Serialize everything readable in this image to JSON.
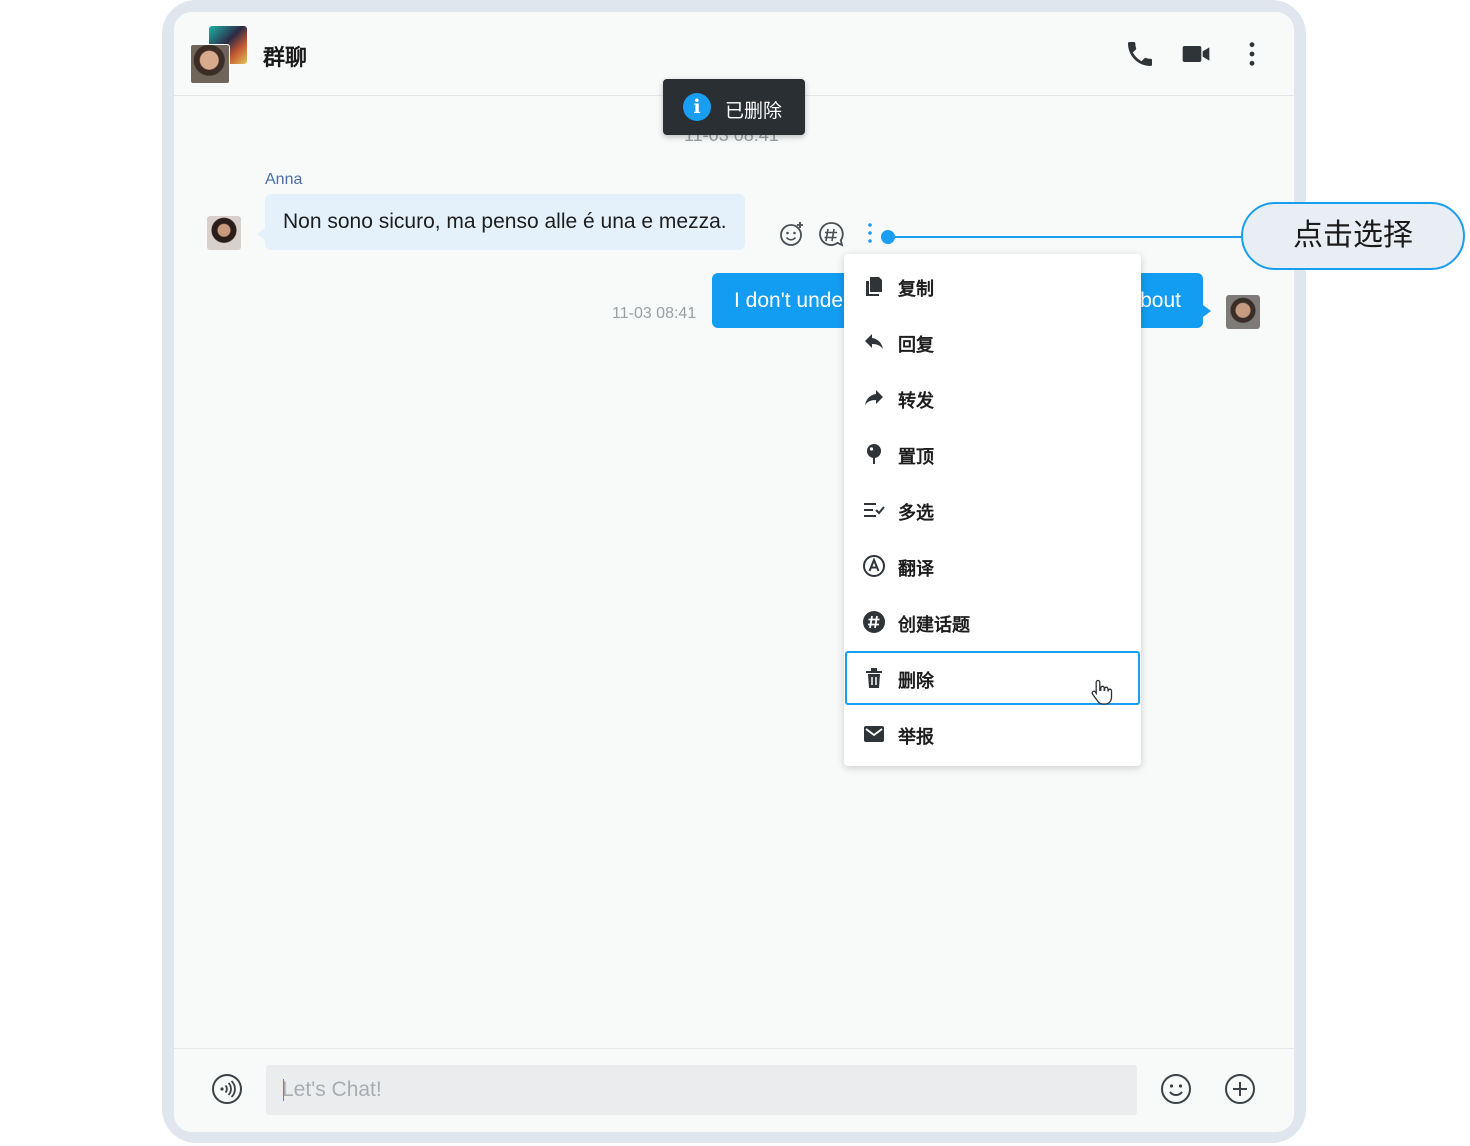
{
  "header": {
    "title": "群聊",
    "icons": [
      "phone-icon",
      "video-camera-icon",
      "more-vertical-icon"
    ]
  },
  "toast": {
    "icon": "info-icon",
    "text": "已删除"
  },
  "timestamp_partial": "11-03 08:41",
  "messages": [
    {
      "sender": "Anna",
      "text": "Non sono sicuro, ma penso alle é una e mezza.",
      "direction": "incoming"
    },
    {
      "text_visible_start": "I don't unde",
      "text_visible_end": "bout",
      "time": "11-03 08:41",
      "direction": "outgoing"
    }
  ],
  "message_tools": [
    "add-reaction-icon",
    "thread-icon",
    "more-vertical-icon"
  ],
  "context_menu": {
    "items": [
      {
        "label": "复制",
        "icon": "copy-icon"
      },
      {
        "label": "回复",
        "icon": "reply-icon"
      },
      {
        "label": "转发",
        "icon": "forward-icon"
      },
      {
        "label": "置顶",
        "icon": "pin-icon"
      },
      {
        "label": "多选",
        "icon": "multi-select-icon"
      },
      {
        "label": "翻译",
        "icon": "translate-icon"
      },
      {
        "label": "创建话题",
        "icon": "create-thread-icon"
      },
      {
        "label": "删除",
        "icon": "trash-icon",
        "highlighted": true
      },
      {
        "label": "举报",
        "icon": "report-icon"
      }
    ]
  },
  "composer": {
    "placeholder": "Let's Chat!",
    "icons": [
      "voice-icon",
      "emoji-icon",
      "plus-icon"
    ]
  },
  "annotation": {
    "label": "点击选择"
  },
  "colors": {
    "accent": "#1a9ef2",
    "outgoing_bubble": "#129cf2",
    "incoming_bubble": "#e4f1fb",
    "toast_bg": "#2a2f33"
  }
}
